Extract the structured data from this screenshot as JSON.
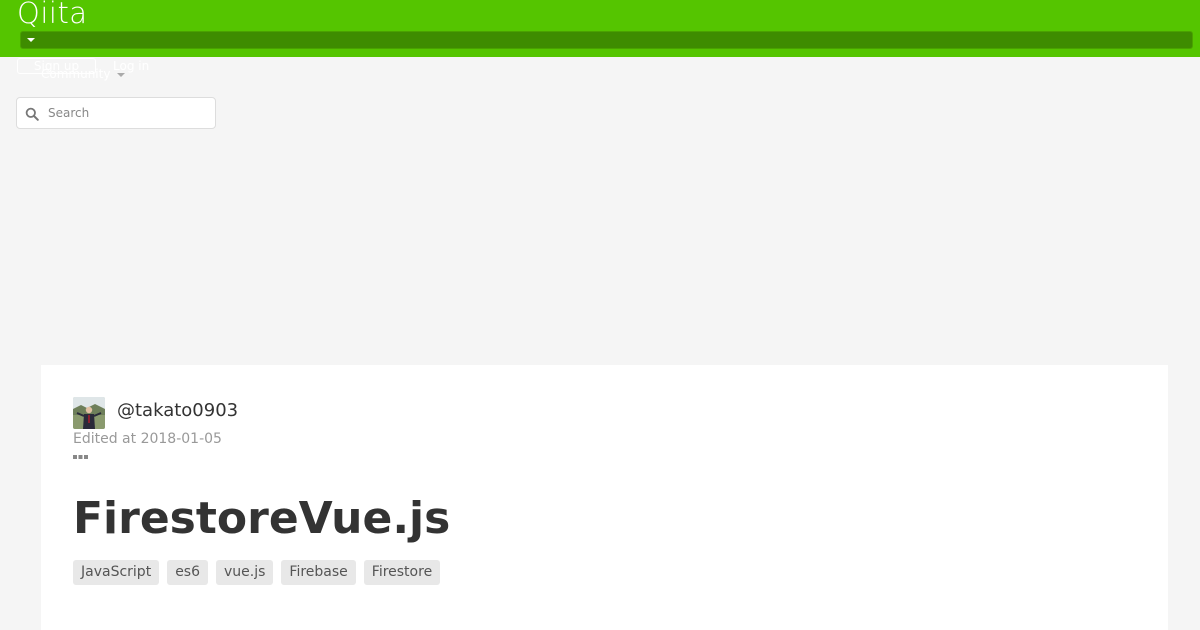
{
  "header": {
    "logo": "Qiita",
    "signup_label": "Sign up",
    "login_label": "Log in",
    "community_label": "Community"
  },
  "search": {
    "placeholder": "Search"
  },
  "article": {
    "author": "@takato0903",
    "edited": "Edited at 2018-01-05",
    "title": "FirestoreVue.js",
    "tags": [
      "JavaScript",
      "es6",
      "vue.js",
      "Firebase",
      "Firestore"
    ]
  },
  "colors": {
    "brand": "#55c500",
    "brand_dark": "#3e8c00",
    "page_bg": "#f5f5f5"
  },
  "icons": {
    "search": "search-icon",
    "more": "more-icon",
    "caret": "caret-down-icon"
  }
}
